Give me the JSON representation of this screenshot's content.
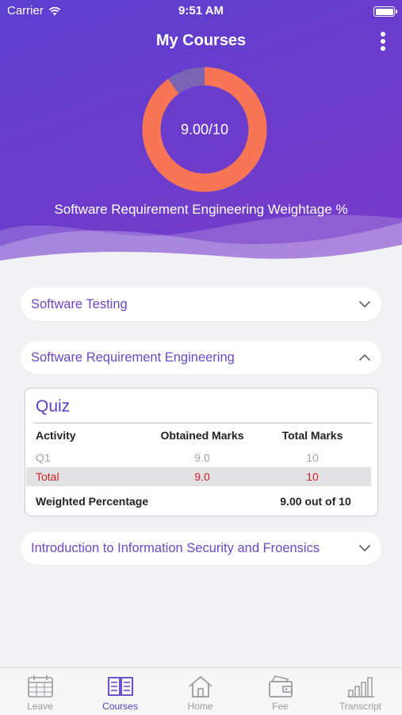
{
  "status_bar": {
    "carrier": "Carrier",
    "time": "9:51 AM"
  },
  "header": {
    "title": "My Courses",
    "menu_icon": "kebab-menu-icon"
  },
  "donut": {
    "value_label": "9.00/10",
    "obtained": 9.0,
    "total": 10,
    "caption": "Software Requirement Engineering Weightage %",
    "colors": {
      "filled": "#f87556",
      "remaining": "#7a65b4"
    }
  },
  "courses": [
    {
      "name": "Software Testing",
      "expanded": false
    },
    {
      "name": "Software Requirement Engineering",
      "expanded": true
    },
    {
      "name": "Introduction to Information Security and Froensics",
      "expanded": false
    }
  ],
  "quiz": {
    "title": "Quiz",
    "columns": [
      "Activity",
      "Obtained Marks",
      "Total Marks"
    ],
    "rows": [
      {
        "activity": "Q1",
        "obtained": "9.0",
        "total": "10"
      }
    ],
    "total_row": {
      "label": "Total",
      "obtained": "9.0",
      "total": "10"
    },
    "weighted": {
      "label": "Weighted Percentage",
      "value": "9.00 out of 10"
    }
  },
  "tabs": [
    {
      "label": "Leave",
      "icon": "calendar-icon",
      "active": false
    },
    {
      "label": "Courses",
      "icon": "book-icon",
      "active": true
    },
    {
      "label": "Home",
      "icon": "home-icon",
      "active": false
    },
    {
      "label": "Fee",
      "icon": "wallet-icon",
      "active": false
    },
    {
      "label": "Transcript",
      "icon": "bar-chart-icon",
      "active": false
    }
  ],
  "colors": {
    "primary": "#5a3ec2",
    "accent": "#f87556",
    "alert": "#d3202a"
  }
}
